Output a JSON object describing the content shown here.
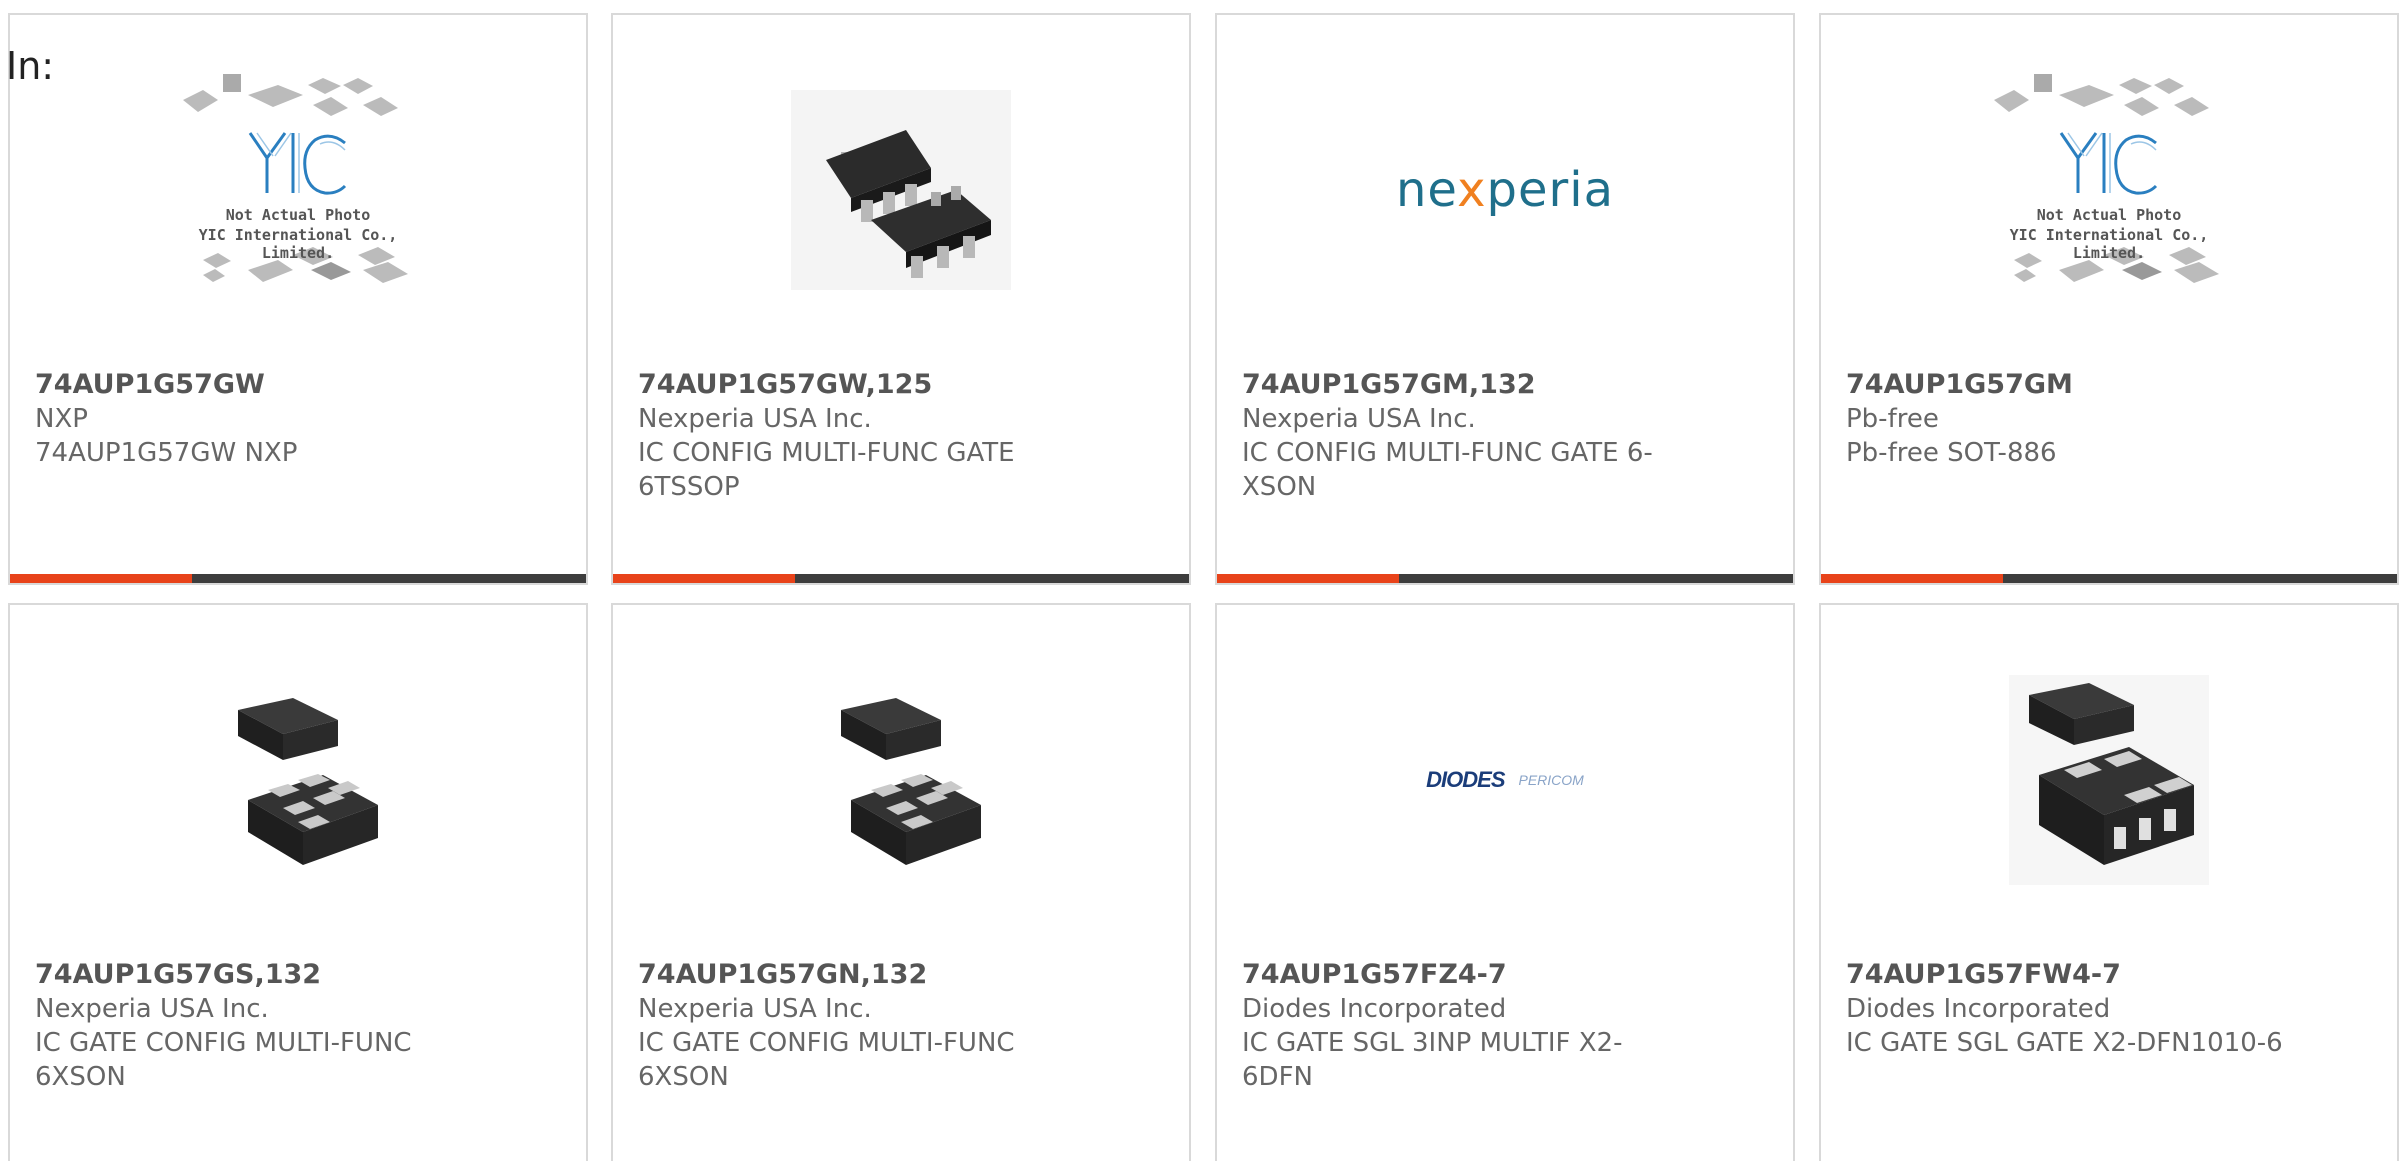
{
  "filter": {
    "label": "In:"
  },
  "colors": {
    "accent": "#e8431a",
    "bar": "#3d3d3d",
    "border": "#d9d9d9"
  },
  "products": [
    {
      "part": "74AUP1G57GW",
      "manufacturer": "NXP",
      "description": "74AUP1G57GW NXP",
      "image": "yic-placeholder",
      "placeholder_line1": "Not Actual Photo",
      "placeholder_line2": "YIC International Co., Limited."
    },
    {
      "part": "74AUP1G57GW,125",
      "manufacturer": "Nexperia USA Inc.",
      "description": "IC CONFIG MULTI-FUNC GATE 6TSSOP",
      "image": "tssop-package"
    },
    {
      "part": "74AUP1G57GM,132",
      "manufacturer": "Nexperia USA Inc.",
      "description": "IC CONFIG MULTI-FUNC GATE 6-XSON",
      "image": "nexperia-logo",
      "logo_text": "nexperia"
    },
    {
      "part": "74AUP1G57GM",
      "manufacturer": "Pb-free",
      "description": "Pb-free SOT-886",
      "image": "yic-placeholder",
      "placeholder_line1": "Not Actual Photo",
      "placeholder_line2": "YIC International Co., Limited."
    },
    {
      "part": "74AUP1G57GS,132",
      "manufacturer": "Nexperia USA Inc.",
      "description": "IC GATE CONFIG MULTI-FUNC 6XSON",
      "image": "xson-package"
    },
    {
      "part": "74AUP1G57GN,132",
      "manufacturer": "Nexperia USA Inc.",
      "description": "IC GATE CONFIG MULTI-FUNC 6XSON",
      "image": "xson-package"
    },
    {
      "part": "74AUP1G57FZ4-7",
      "manufacturer": "Diodes Incorporated",
      "description": "IC GATE SGL 3INP MULTIF X2-6DFN",
      "image": "diodes-logo",
      "logo_text": "DIODES",
      "logo_text2": "PERICOM"
    },
    {
      "part": "74AUP1G57FW4-7",
      "manufacturer": "Diodes Incorporated",
      "description": "IC GATE SGL GATE X2-DFN1010-6",
      "image": "dfn-package"
    }
  ]
}
